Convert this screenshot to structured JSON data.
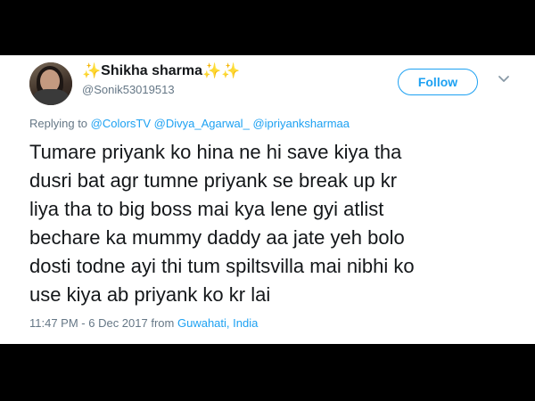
{
  "tweet": {
    "display_name": "Shikha sharma",
    "name_prefix_emoji": "✨",
    "name_suffix_emoji": "✨✨",
    "handle": "@Sonik53019513",
    "follow_label": "Follow",
    "replying_prefix": "Replying to",
    "mentions": [
      "@ColorsTV",
      "@Divya_Agarwal_",
      "@ipriyanksharmaa"
    ],
    "text": "Tumare priyank ko hina ne hi save kiya tha\ndusri bat agr tumne priyank se break up kr\nliya tha to big boss mai kya lene gyi atlist\nbechare ka mummy daddy aa jate yeh bolo\ndosti todne ayi thi tum spiltsvilla mai nibhi ko\nuse kiya ab priyank ko kr lai",
    "timestamp": "11:47 PM - 6 Dec 2017",
    "from_label": "from",
    "location": "Guwahati, India"
  },
  "icons": {
    "avatar": "user-avatar",
    "menu": "chevron-down-icon"
  },
  "colors": {
    "accent": "#1da1f2",
    "text": "#14171a",
    "muted": "#657786",
    "background_band": "#000000"
  }
}
